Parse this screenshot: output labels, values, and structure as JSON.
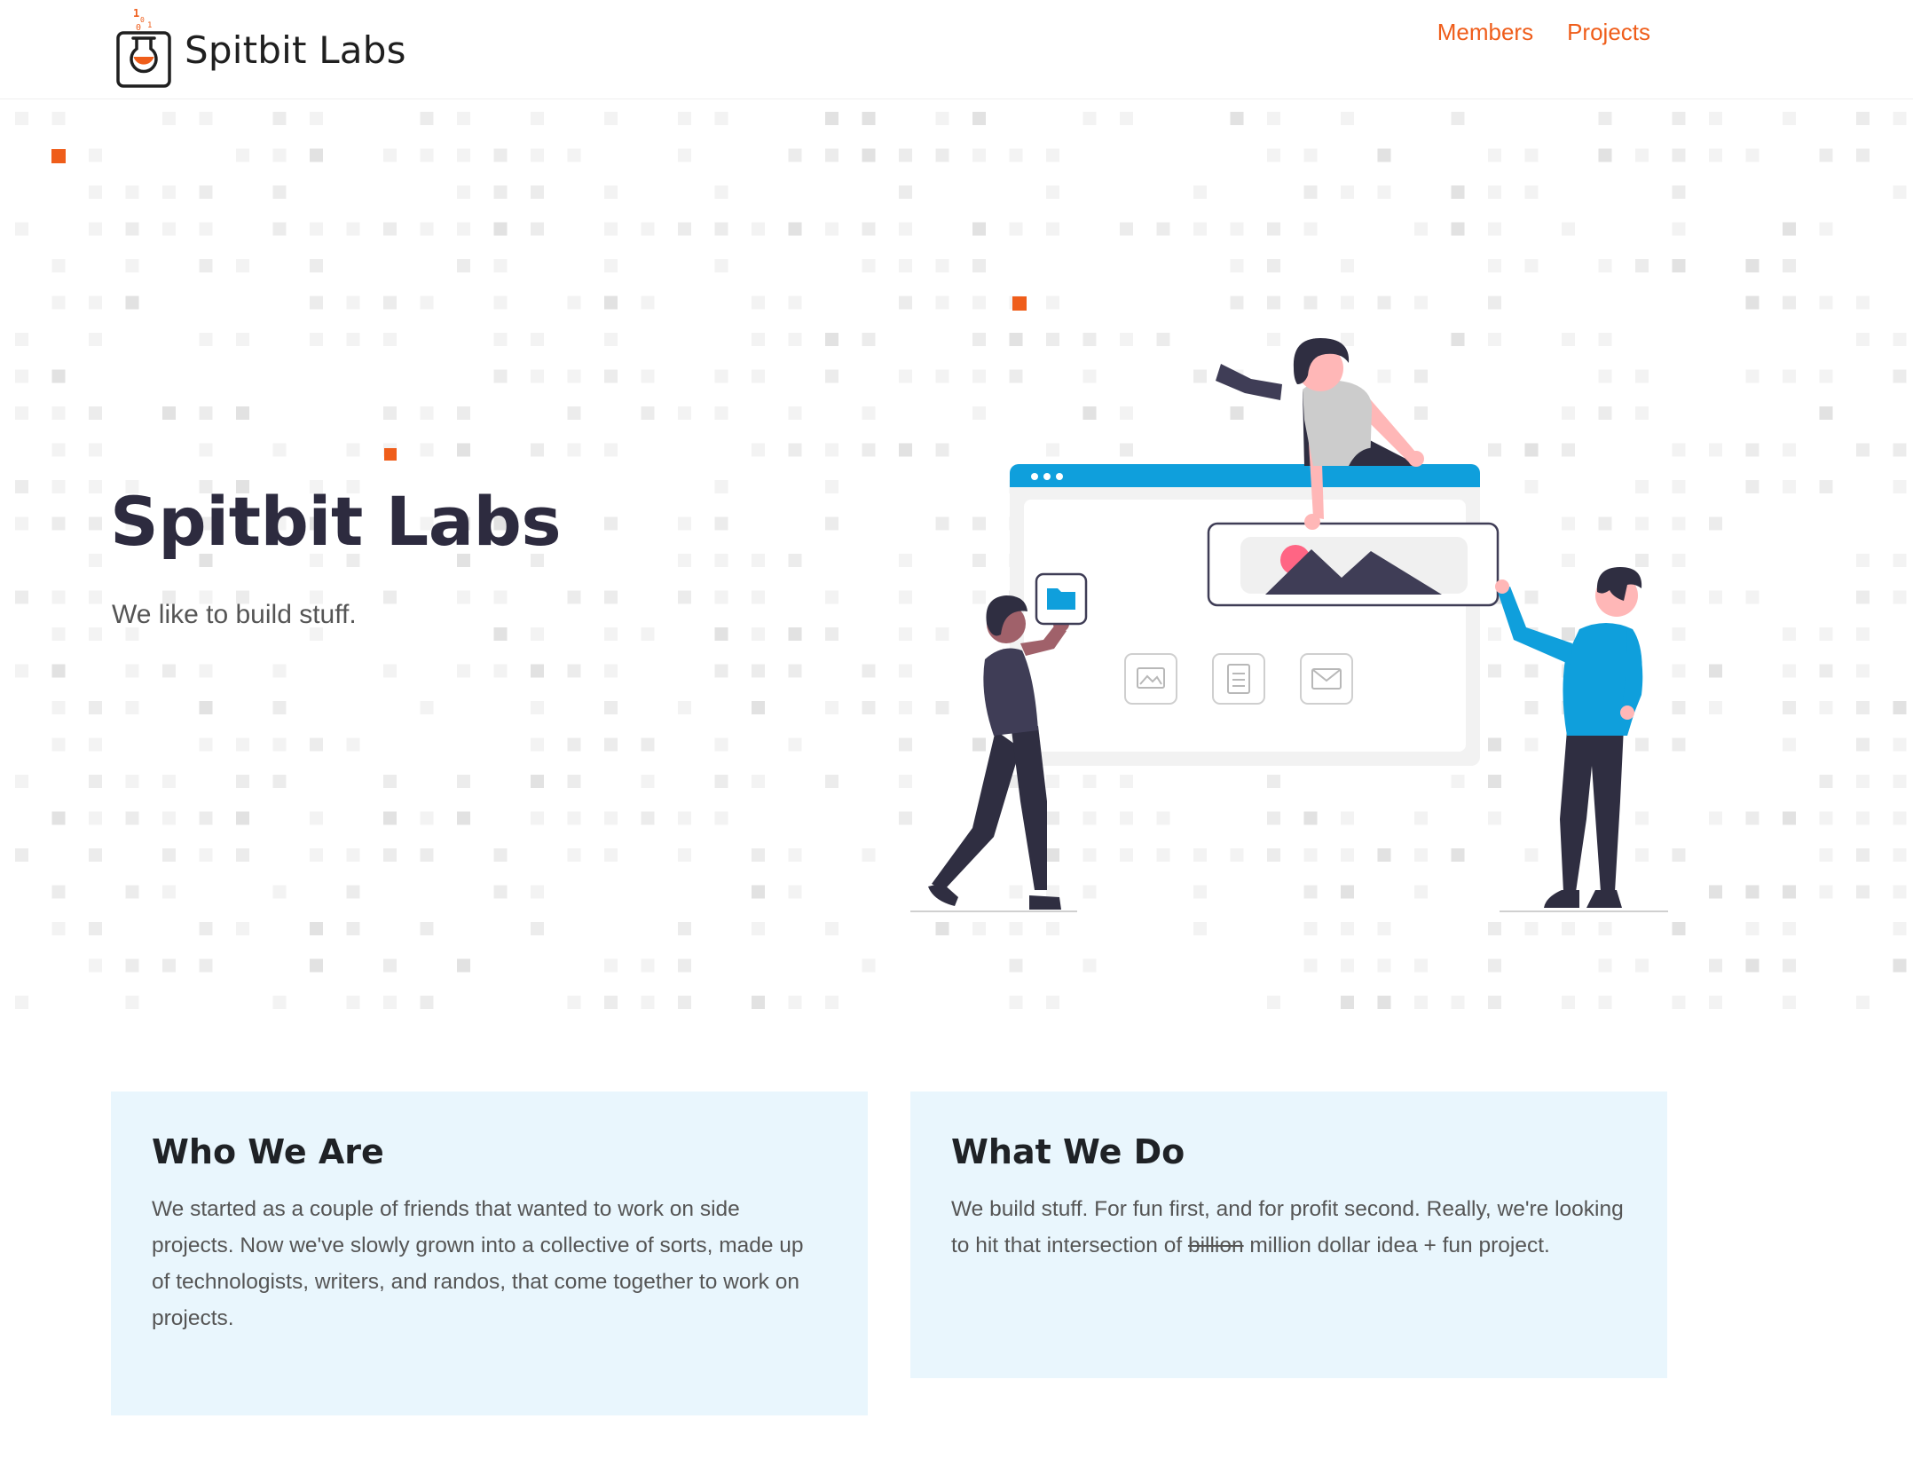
{
  "header": {
    "logo_text": "Spitbit Labs",
    "logo_bits": [
      "1",
      "0",
      "0",
      "1"
    ],
    "nav": [
      {
        "label": "Members"
      },
      {
        "label": "Projects"
      }
    ]
  },
  "hero": {
    "title": "Spitbit Labs",
    "subtitle": "We like to build stuff."
  },
  "cards": [
    {
      "title": "Who We Are",
      "body": "We started as a couple of friends that wanted to work on side projects. Now we've slowly grown into a collective of sorts, made up of technologists, writers, and randos, that come together to work on projects."
    },
    {
      "title": "What We Do",
      "body_before": "We build stuff. For fun first, and for profit second. Really, we're looking to hit that intersection of ",
      "body_strike": "billion",
      "body_after": " million dollar idea + fun project."
    }
  ],
  "colors": {
    "accent": "#ef5d1a",
    "title_dark": "#2d2b3f",
    "card_bg": "#e9f6fd",
    "illustration_blue": "#0f9fdc"
  },
  "icons": [
    "flask-logo-icon",
    "folder-icon",
    "image-icon",
    "document-icon",
    "mail-icon"
  ]
}
